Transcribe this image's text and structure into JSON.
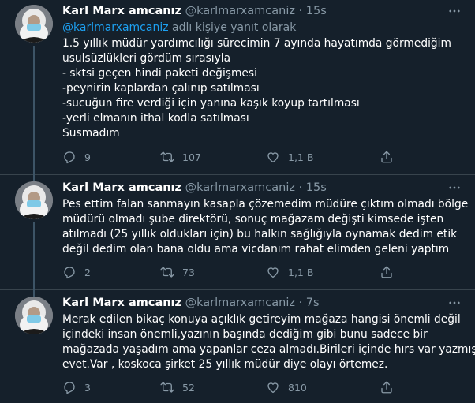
{
  "tweets": [
    {
      "display_name": "Karl Marx amcanız",
      "handle": "@karlmarxamcaniz",
      "dot": "·",
      "time": "15s",
      "reply_handle": "@karlmarxamcaniz",
      "reply_suffix": " adlı kişiye yanıt olarak",
      "lines": [
        "1.5 yıllık  müdür yardımcılığı sürecimin 7 ayında hayatımda görmediğim",
        "usulsüzlükleri gördüm sırasıyla",
        "- sktsi geçen hindi paketi değişmesi",
        "-peynirin kaplardan çalınıp satılması",
        "-sucuğun fire verdiği için yanına kaşık koyup tartılması",
        "-yerli elmanın ithal kodla satılması",
        "Susmadım"
      ],
      "replies": "9",
      "retweets": "107",
      "likes": "1,1 B"
    },
    {
      "display_name": "Karl Marx amcanız",
      "handle": "@karlmarxamcaniz",
      "dot": "·",
      "time": "15s",
      "lines": [
        "Pes ettim falan sanmayın kasapla çözemedim müdüre çıktım olmadı bölge",
        "müdürü olmadı şube direktörü, sonuç mağazam değişti kimsede işten",
        "atılmadı (25 yıllık oldukları için) bu halkın sağlığıyla oynamak dedim etik",
        "değil dedim olan bana oldu ama vicdanım rahat elimden geleni yaptım"
      ],
      "replies": "2",
      "retweets": "73",
      "likes": "1,1 B"
    },
    {
      "display_name": "Karl Marx amcanız",
      "handle": "@karlmarxamcaniz",
      "dot": "·",
      "time": "7s",
      "lines": [
        "Merak edilen bikaç konuya açıklık getireyim mağaza hangisi önemli değil",
        "içindeki insan önemli,yazının başında dediğim gibi bunu sadece bir",
        "mağazada yaşadım ama yapanlar ceza almadı.Birileri içinde hırs var yazmış",
        "evet.Var , koskoca şirket 25 yıllık müdür diye olayı örtemez."
      ],
      "replies": "3",
      "retweets": "52",
      "likes": "810"
    }
  ],
  "icons": [
    "avatar",
    "more-icon",
    "reply-icon",
    "retweet-icon",
    "like-icon",
    "share-icon"
  ],
  "colors": {
    "background": "#15202b",
    "muted": "#8899a6",
    "link": "#1da1f2",
    "divider": "#38444d"
  }
}
